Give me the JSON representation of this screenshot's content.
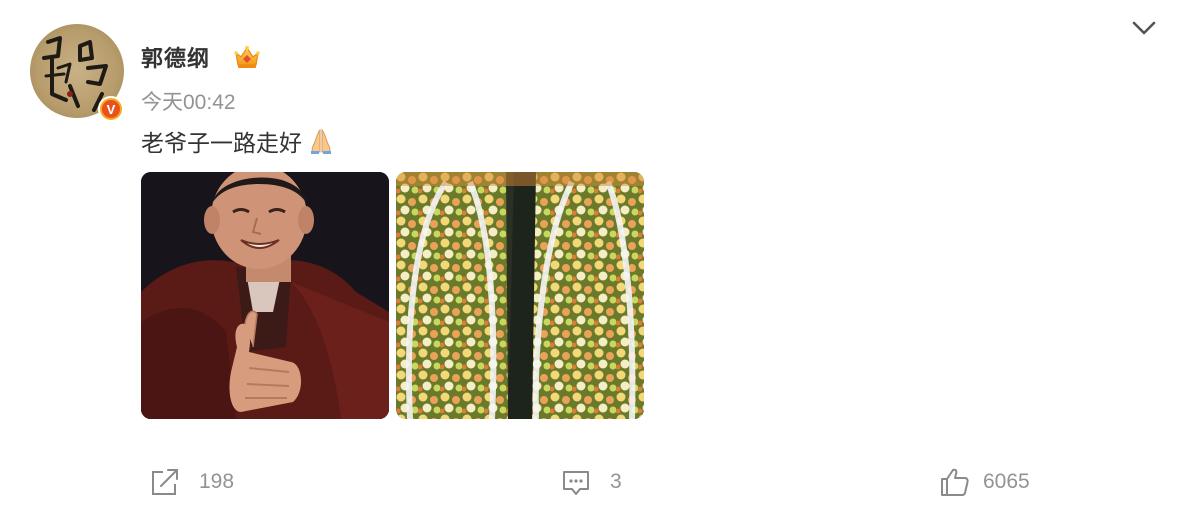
{
  "post": {
    "author": "郭德纲",
    "timestamp": "今天00:42",
    "text": "老爷子一路走好",
    "emoji": "pray-icon",
    "images": [
      {
        "name": "portrait-photo",
        "description_icon": "photo"
      },
      {
        "name": "funeral-wreaths-photo",
        "description_icon": "photo"
      }
    ]
  },
  "actions": {
    "repost_count": "198",
    "comment_count": "3",
    "like_count": "6065"
  },
  "colors": {
    "text": "#333333",
    "muted": "#939393",
    "badge": "#f7ad1b",
    "badge_inner": "#e8521f"
  }
}
